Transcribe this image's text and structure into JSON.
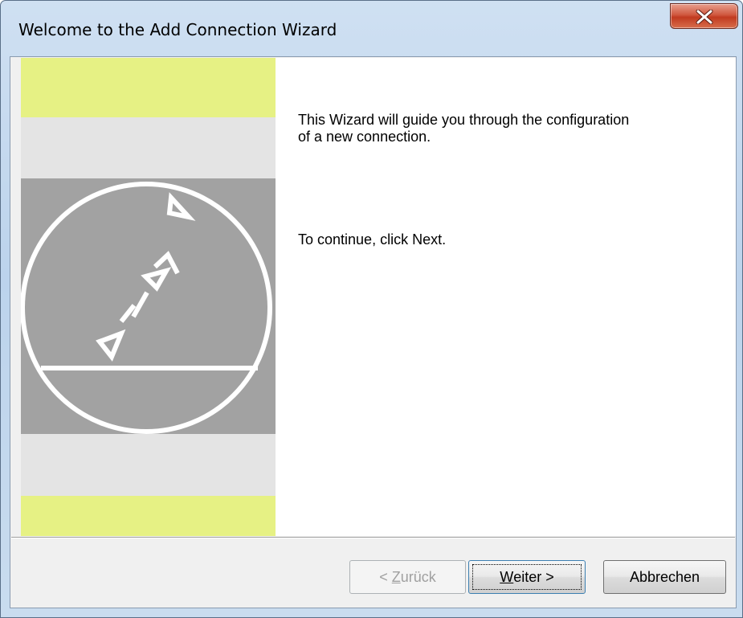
{
  "window": {
    "title": "Welcome to the Add Connection Wizard",
    "close_icon": "close-icon"
  },
  "banner": {
    "colors": {
      "yellow": "#e6f184",
      "light": "#e4e4e4",
      "gray": "#a2a2a2",
      "logo_stroke": "#ffffff"
    },
    "logo_icon": "heidenhain-circle-logo"
  },
  "content": {
    "intro": "This Wizard will guide you through the configuration of a new connection.",
    "continue": "To continue, click Next."
  },
  "buttons": {
    "back": {
      "prefix": "< ",
      "mnemonic": "Z",
      "rest": "urück",
      "enabled": false
    },
    "next": {
      "mnemonic": "W",
      "rest": "eiter >",
      "enabled": true
    },
    "cancel": {
      "label": "Abbrechen",
      "enabled": true
    }
  }
}
